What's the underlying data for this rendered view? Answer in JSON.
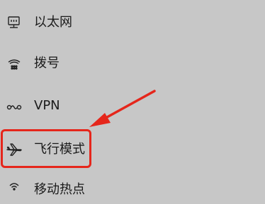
{
  "network_nav": {
    "items": [
      {
        "id": "ethernet",
        "label": "以太网",
        "icon": "ethernet-icon"
      },
      {
        "id": "dialup",
        "label": "拨号",
        "icon": "dialup-phone-icon"
      },
      {
        "id": "vpn",
        "label": "VPN",
        "icon": "vpn-icon"
      },
      {
        "id": "airplane",
        "label": "飞行模式",
        "icon": "airplane-icon"
      },
      {
        "id": "hotspot",
        "label": "移动热点",
        "icon": "mobile-hotspot-icon"
      }
    ]
  },
  "annotation": {
    "highlight_color": "#e5261b",
    "highlighted_item": "airplane"
  }
}
